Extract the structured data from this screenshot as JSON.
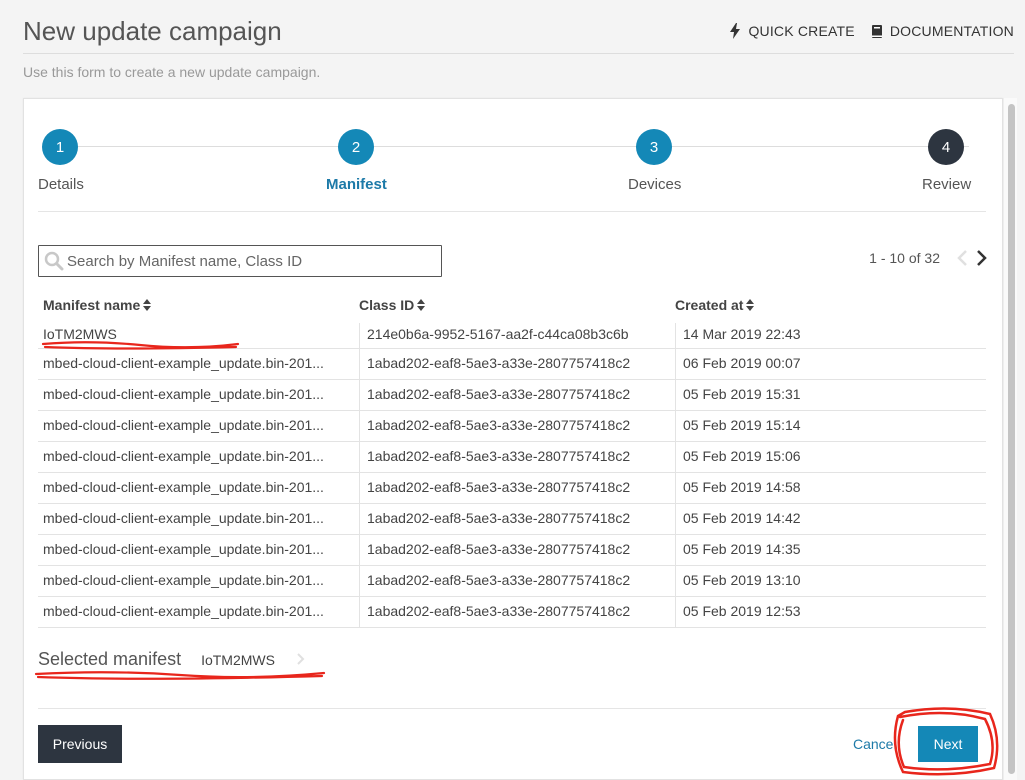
{
  "header": {
    "title": "New update campaign",
    "quick_create": "QUICK CREATE",
    "documentation": "DOCUMENTATION",
    "subtitle": "Use this form to create a new update campaign."
  },
  "stepper": {
    "steps": [
      {
        "number": "1",
        "label": "Details",
        "state": "completed"
      },
      {
        "number": "2",
        "label": "Manifest",
        "state": "active"
      },
      {
        "number": "3",
        "label": "Devices",
        "state": "upcoming"
      },
      {
        "number": "4",
        "label": "Review",
        "state": "final"
      }
    ]
  },
  "search": {
    "placeholder": "Search by Manifest name, Class ID",
    "value": ""
  },
  "pagination": {
    "text": "1 - 10 of 32"
  },
  "table": {
    "columns": [
      "Manifest name",
      "Class ID",
      "Created at"
    ],
    "rows": [
      {
        "name": "IoTM2MWS",
        "class_id": "214e0b6a-9952-5167-aa2f-c44ca08b3c6b",
        "created": "14 Mar 2019 22:43"
      },
      {
        "name": "mbed-cloud-client-example_update.bin-201...",
        "class_id": "1abad202-eaf8-5ae3-a33e-2807757418c2",
        "created": "06 Feb 2019 00:07"
      },
      {
        "name": "mbed-cloud-client-example_update.bin-201...",
        "class_id": "1abad202-eaf8-5ae3-a33e-2807757418c2",
        "created": "05 Feb 2019 15:31"
      },
      {
        "name": "mbed-cloud-client-example_update.bin-201...",
        "class_id": "1abad202-eaf8-5ae3-a33e-2807757418c2",
        "created": "05 Feb 2019 15:14"
      },
      {
        "name": "mbed-cloud-client-example_update.bin-201...",
        "class_id": "1abad202-eaf8-5ae3-a33e-2807757418c2",
        "created": "05 Feb 2019 15:06"
      },
      {
        "name": "mbed-cloud-client-example_update.bin-201...",
        "class_id": "1abad202-eaf8-5ae3-a33e-2807757418c2",
        "created": "05 Feb 2019 14:58"
      },
      {
        "name": "mbed-cloud-client-example_update.bin-201...",
        "class_id": "1abad202-eaf8-5ae3-a33e-2807757418c2",
        "created": "05 Feb 2019 14:42"
      },
      {
        "name": "mbed-cloud-client-example_update.bin-201...",
        "class_id": "1abad202-eaf8-5ae3-a33e-2807757418c2",
        "created": "05 Feb 2019 14:35"
      },
      {
        "name": "mbed-cloud-client-example_update.bin-201...",
        "class_id": "1abad202-eaf8-5ae3-a33e-2807757418c2",
        "created": "05 Feb 2019 13:10"
      },
      {
        "name": "mbed-cloud-client-example_update.bin-201...",
        "class_id": "1abad202-eaf8-5ae3-a33e-2807757418c2",
        "created": "05 Feb 2019 12:53"
      }
    ]
  },
  "selected": {
    "label": "Selected manifest",
    "value": "IoTM2MWS"
  },
  "footer": {
    "previous": "Previous",
    "cancel": "Cancel",
    "next": "Next"
  },
  "colors": {
    "accent": "#1488b7",
    "step_active": "#1d7aa8",
    "step_final": "#2d3540",
    "annotation": "#e8261c"
  },
  "icons": {
    "quick_create": "lightning-icon",
    "documentation": "book-icon",
    "search": "search-icon",
    "sort": "sort-icon",
    "prev_page": "chevron-left-icon",
    "next_page": "chevron-right-icon"
  }
}
